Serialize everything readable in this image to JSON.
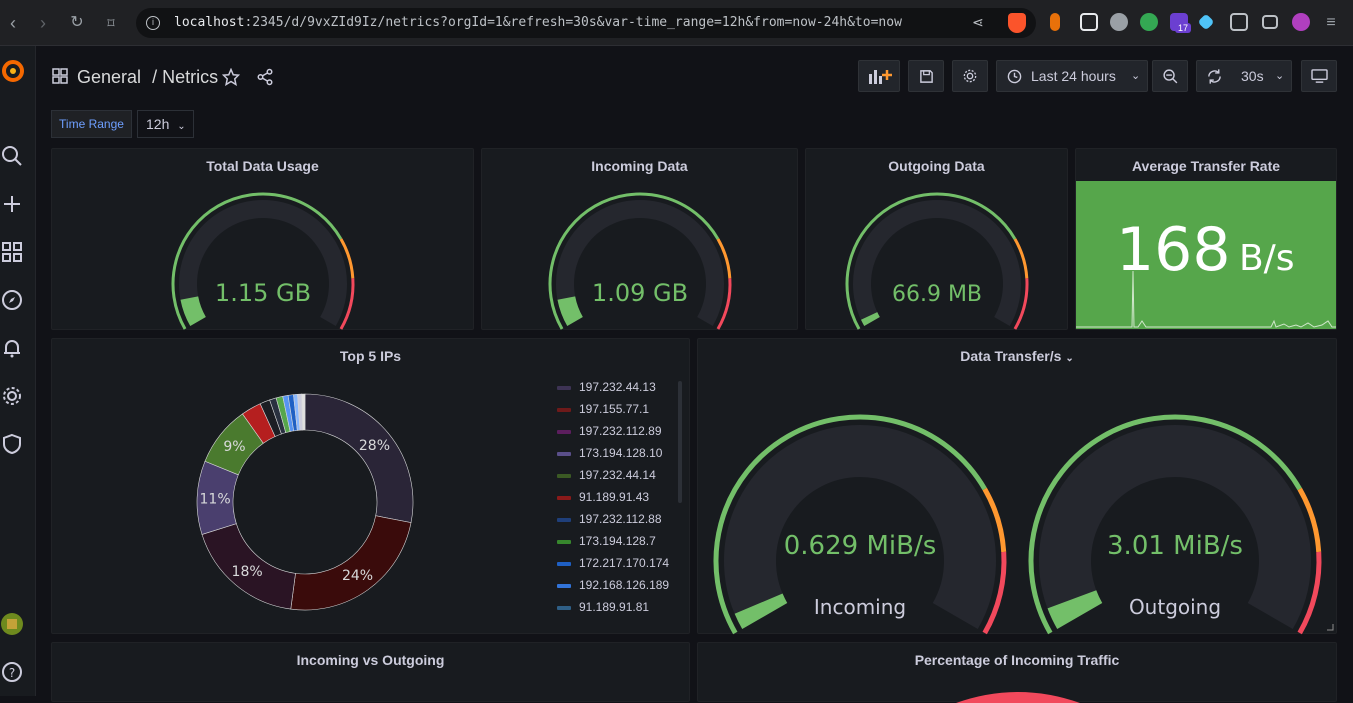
{
  "browser": {
    "url_host": "localhost",
    "url_rest": ":2345/d/9vxZId9Iz/netrics?orgId=1&refresh=30s&var-time_range=12h&from=now-24h&to=now",
    "ext_badge": "17"
  },
  "breadcrumb": {
    "folder": "General",
    "separator": "/",
    "dashboard": "Netrics"
  },
  "toolbar": {
    "time_range": "Last 24 hours",
    "refresh_interval": "30s"
  },
  "variables": {
    "time_range_label": "Time Range",
    "time_range_value": "12h"
  },
  "panels": {
    "total": {
      "title": "Total Data Usage",
      "value": "1.15 GB",
      "fraction": 0.08
    },
    "incoming": {
      "title": "Incoming Data",
      "value": "1.09 GB",
      "fraction": 0.08
    },
    "outgoing": {
      "title": "Outgoing Data",
      "value": "66.9 MB",
      "fraction": 0.02
    },
    "rate": {
      "title": "Average Transfer Rate",
      "value": "168",
      "unit": "B/s"
    },
    "top_ips": {
      "title": "Top 5 IPs",
      "legend": [
        {
          "label": "197.232.44.13",
          "color": "#3d3354"
        },
        {
          "label": "197.155.77.1",
          "color": "#6e1a1a"
        },
        {
          "label": "197.232.112.89",
          "color": "#5c1e5e"
        },
        {
          "label": "173.194.128.10",
          "color": "#5a4f8a"
        },
        {
          "label": "197.232.44.14",
          "color": "#3b5a24"
        },
        {
          "label": "91.189.91.43",
          "color": "#8a1a1a"
        },
        {
          "label": "197.232.112.88",
          "color": "#1f3f7a"
        },
        {
          "label": "173.194.128.7",
          "color": "#37872d"
        },
        {
          "label": "172.217.170.174",
          "color": "#1f60c4"
        },
        {
          "label": "192.168.126.189",
          "color": "#3274d9"
        },
        {
          "label": "91.189.91.81",
          "color": "#2f5f86"
        }
      ],
      "slices": [
        {
          "label": "28%",
          "percent": 28,
          "color": "#2a2537"
        },
        {
          "label": "24%",
          "percent": 24,
          "color": "#3a0b0b"
        },
        {
          "label": "18%",
          "percent": 18,
          "color": "#2a1424"
        },
        {
          "label": "11%",
          "percent": 11,
          "color": "#4a3f6e"
        },
        {
          "label": "9%",
          "percent": 9,
          "color": "#4a7a2e"
        },
        {
          "label": "",
          "percent": 3,
          "color": "#b51f1f"
        },
        {
          "label": "",
          "percent": 1.5,
          "color": "#1c1e24"
        },
        {
          "label": "",
          "percent": 1,
          "color": "#2a3140"
        },
        {
          "label": "",
          "percent": 1,
          "color": "#56a64b"
        },
        {
          "label": "",
          "percent": 0.8,
          "color": "#5794f2"
        },
        {
          "label": "",
          "percent": 0.8,
          "color": "#1f60c4"
        },
        {
          "label": "",
          "percent": 0.6,
          "color": "#8ab8ff"
        },
        {
          "label": "",
          "percent": 0.6,
          "color": "#ccccdc"
        },
        {
          "label": "",
          "percent": 0.5,
          "color": "#e0e0e0"
        }
      ]
    },
    "transfer": {
      "title": "Data Transfer/s",
      "gauges": [
        {
          "value": "0.629 MiB/s",
          "label": "Incoming",
          "fraction": 0.03
        },
        {
          "value": "3.01 MiB/s",
          "label": "Outgoing",
          "fraction": 0.04
        }
      ]
    },
    "in_vs_out": {
      "title": "Incoming vs Outgoing"
    },
    "pct_in": {
      "title": "Percentage of Incoming Traffic"
    }
  },
  "colors": {
    "green": "#73bf69",
    "orange": "#ff9830",
    "red": "#f2495c",
    "track": "#25272e"
  }
}
